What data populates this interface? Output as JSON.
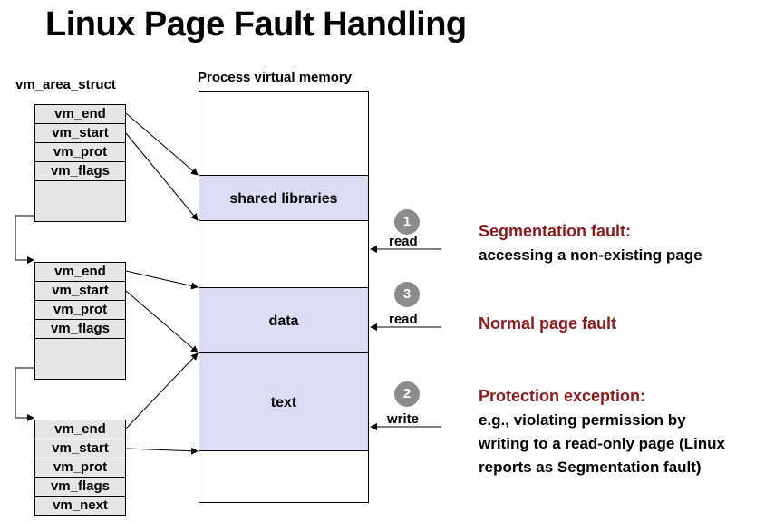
{
  "title": "Linux Page Fault Handling",
  "struct_label": "vm_area_struct",
  "vm_label": "Process virtual memory",
  "structs": [
    {
      "fields": [
        "vm_end",
        "vm_start",
        "vm_prot",
        "vm_flags"
      ]
    },
    {
      "fields": [
        "vm_end",
        "vm_start",
        "vm_prot",
        "vm_flags"
      ]
    },
    {
      "fields": [
        "vm_end",
        "vm_start",
        "vm_prot",
        "vm_flags",
        "vm_next"
      ]
    }
  ],
  "regions": {
    "shared": "shared libraries",
    "data": "data",
    "text": "text"
  },
  "accesses": [
    {
      "number": "1",
      "op": "read"
    },
    {
      "number": "3",
      "op": "read"
    },
    {
      "number": "2",
      "op": "write"
    }
  ],
  "faults": [
    {
      "title": "Segmentation fault:",
      "desc": [
        "accessing a non-existing page"
      ]
    },
    {
      "title": "Normal page fault",
      "desc": []
    },
    {
      "title": "Protection exception:",
      "desc": [
        "e.g., violating permission by",
        "writing to a read-only page (Linux",
        "reports as Segmentation fault)"
      ]
    }
  ],
  "colors": {
    "region_fill": "#dcdcf4",
    "field_fill": "#e6e6e6",
    "fault_title": "#8b1a1a",
    "badge": "#8c8c8c"
  }
}
